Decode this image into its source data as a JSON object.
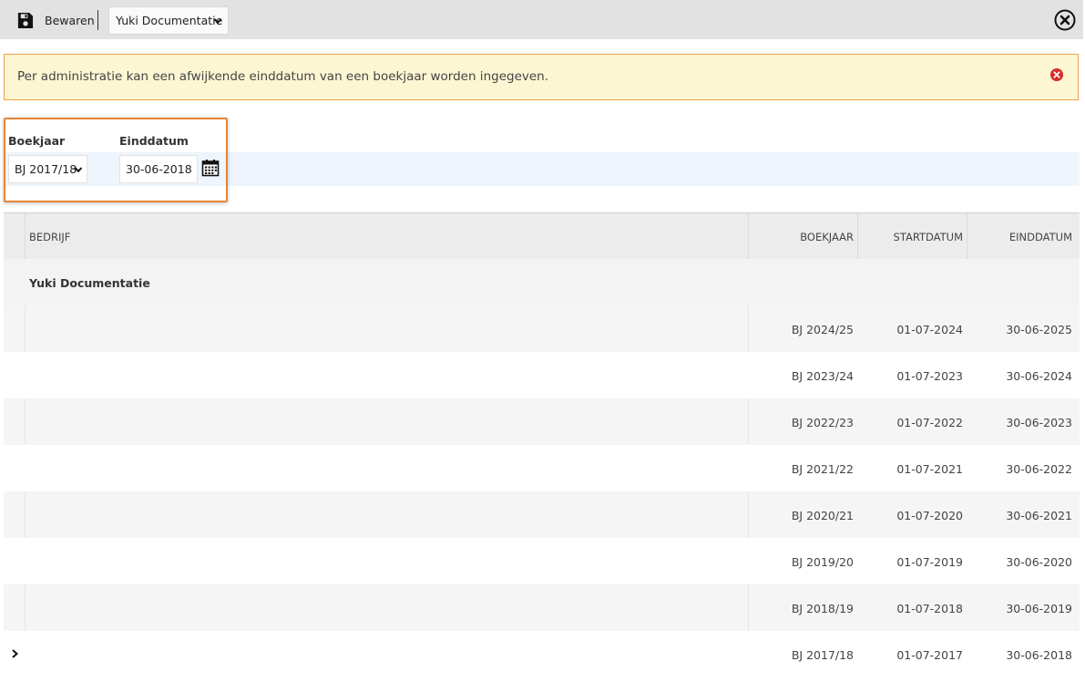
{
  "toolbar": {
    "save_label": "Bewaren",
    "admin_select_value": "Yuki Documentatie"
  },
  "banner": {
    "text": "Per administratie kan een afwijkende einddatum van een boekjaar worden ingegeven."
  },
  "filter": {
    "boekjaar_label": "Boekjaar",
    "boekjaar_value": "BJ 2017/18",
    "einddatum_label": "Einddatum",
    "einddatum_value": "30-06-2018"
  },
  "table": {
    "headers": {
      "bedrijf": "BEDRIJF",
      "boekjaar": "BOEKJAAR",
      "startdatum": "STARTDATUM",
      "einddatum": "EINDDATUM"
    },
    "group_label": "Yuki Documentatie",
    "rows": [
      {
        "boekjaar": "BJ 2024/25",
        "start": "01-07-2024",
        "eind": "30-06-2025"
      },
      {
        "boekjaar": "BJ 2023/24",
        "start": "01-07-2023",
        "eind": "30-06-2024"
      },
      {
        "boekjaar": "BJ 2022/23",
        "start": "01-07-2022",
        "eind": "30-06-2023"
      },
      {
        "boekjaar": "BJ 2021/22",
        "start": "01-07-2021",
        "eind": "30-06-2022"
      },
      {
        "boekjaar": "BJ 2020/21",
        "start": "01-07-2020",
        "eind": "30-06-2021"
      },
      {
        "boekjaar": "BJ 2019/20",
        "start": "01-07-2019",
        "eind": "30-06-2020"
      },
      {
        "boekjaar": "BJ 2018/19",
        "start": "01-07-2018",
        "eind": "30-06-2019"
      },
      {
        "boekjaar": "BJ 2017/18",
        "start": "01-07-2017",
        "eind": "30-06-2018"
      }
    ]
  },
  "icons": {
    "save": "floppy-disk-icon",
    "close": "close-circle-icon",
    "banner_close": "red-x-circle-icon",
    "calendar": "calendar-icon",
    "expander": "chevron-right-icon"
  },
  "colors": {
    "banner_bg": "#fdf6d3",
    "banner_border": "#f0a04b",
    "highlight_border": "#e88535",
    "error_red": "#d62c2c"
  }
}
